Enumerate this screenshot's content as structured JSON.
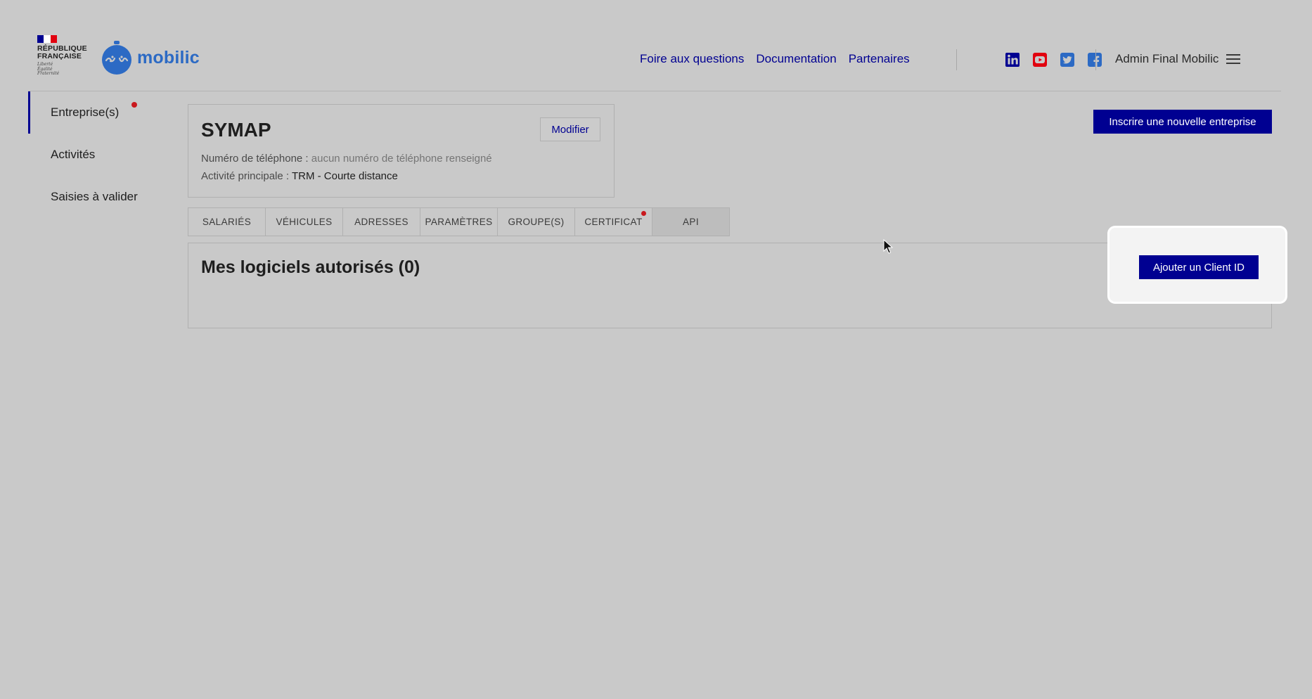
{
  "header": {
    "republique_line1": "RÉPUBLIQUE",
    "republique_line2": "FRANÇAISE",
    "devise": [
      "Liberté",
      "Égalité",
      "Fraternité"
    ],
    "app_name": "mobilic",
    "nav": [
      "Foire aux questions",
      "Documentation",
      "Partenaires"
    ],
    "socials": [
      "linkedin-icon",
      "youtube-icon",
      "twitter-icon",
      "facebook-icon"
    ],
    "user_name": "Admin Final Mobilic"
  },
  "sidebar": {
    "items": [
      {
        "label": "Entreprise(s)",
        "active": true,
        "badge": true
      },
      {
        "label": "Activités"
      },
      {
        "label": "Saisies à valider"
      }
    ]
  },
  "company": {
    "name": "SYMAP",
    "edit_label": "Modifier",
    "phone_label": "Numéro de téléphone :",
    "phone_value": "aucun numéro de téléphone renseigné",
    "activity_label": "Activité principale :",
    "activity_value": "TRM - Courte distance"
  },
  "register_button": "Inscrire une nouvelle entreprise",
  "tabs": [
    {
      "label": "SALARIÉS"
    },
    {
      "label": "VÉHICULES"
    },
    {
      "label": "ADRESSES"
    },
    {
      "label": "PARAMÈTRES"
    },
    {
      "label": "GROUPE(S)"
    },
    {
      "label": "CERTIFICAT",
      "badge": true
    },
    {
      "label": "API",
      "active": true
    }
  ],
  "api_panel": {
    "title": "Mes logiciels autorisés (0)",
    "add_button": "Ajouter un Client ID"
  },
  "colors": {
    "primary": "#000091",
    "brand": "#2c6ac4",
    "badge": "#c9191e",
    "background": "#c9c9c9"
  }
}
